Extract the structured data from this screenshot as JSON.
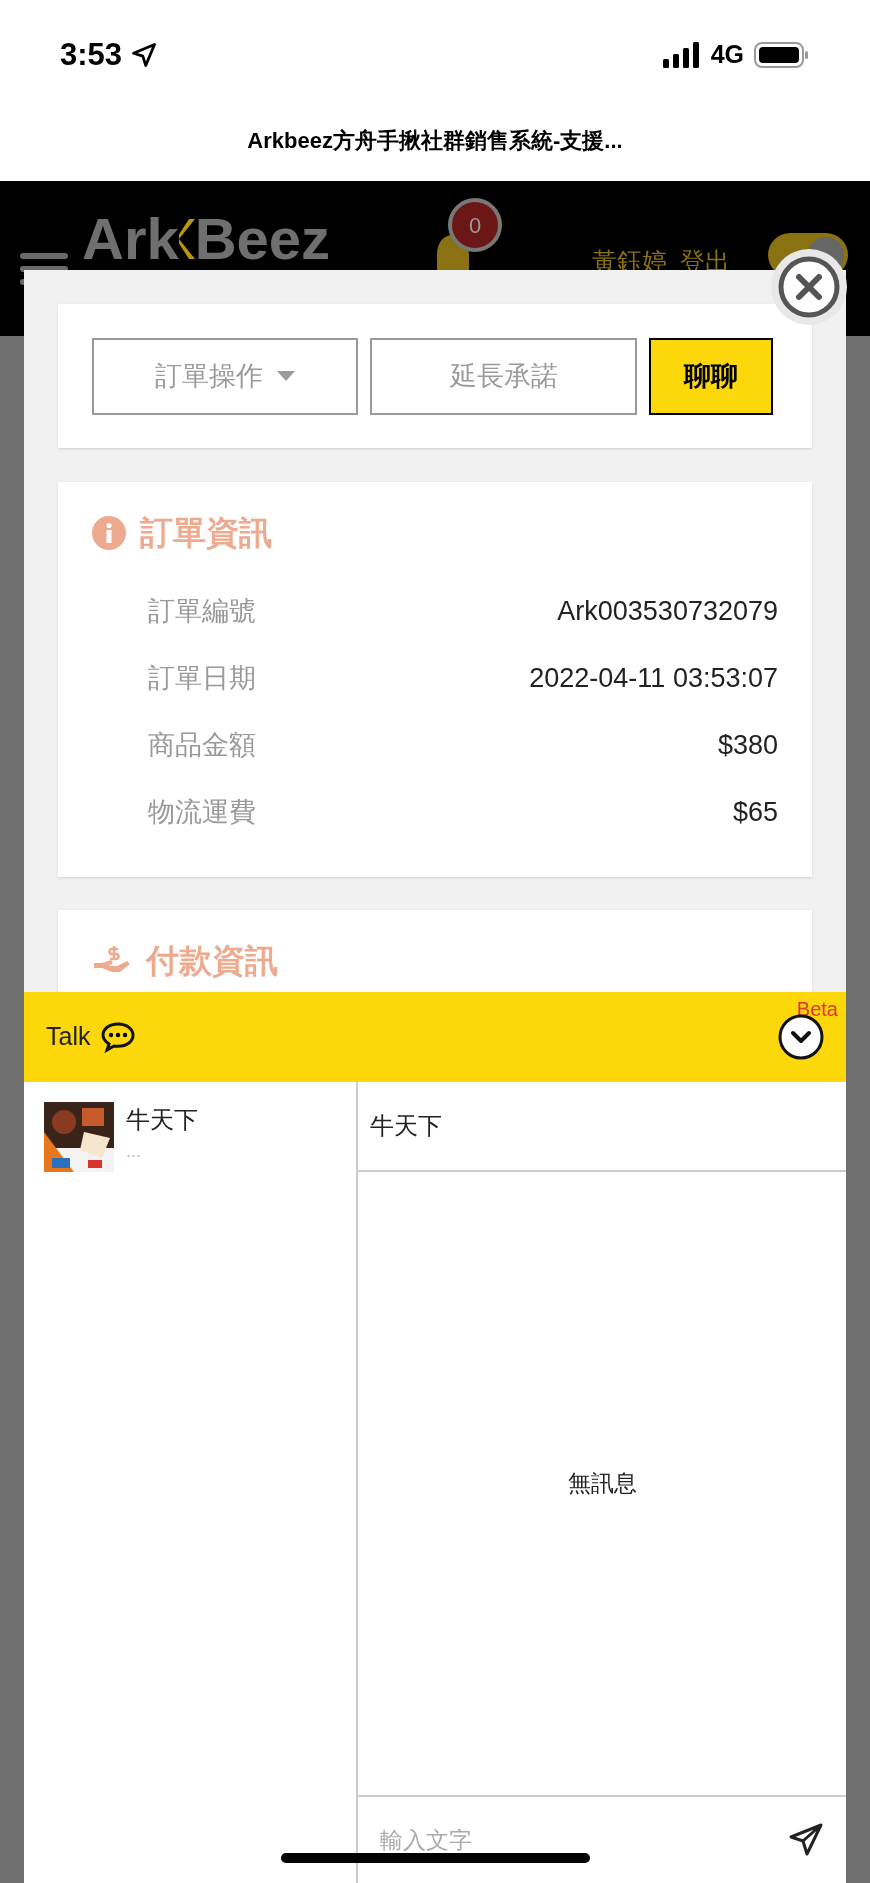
{
  "status_bar": {
    "time": "3:53",
    "network": "4G"
  },
  "browser": {
    "title": "Arkbeez方舟手揪社群銷售系統-支援..."
  },
  "header": {
    "logo": {
      "left": "Ark",
      "right": "Beez"
    },
    "notification_count": "0",
    "user_name": "黃鈺婷",
    "logout": "登出",
    "toggle_on": true
  },
  "actions": [
    {
      "kind": "dropdown",
      "label": "訂單操作"
    },
    {
      "kind": "outline",
      "label": "延長承諾"
    },
    {
      "kind": "primary",
      "label": "聊聊"
    }
  ],
  "order_info": {
    "title": "訂單資訊",
    "rows": [
      {
        "label": "訂單編號",
        "value": "Ark003530732079"
      },
      {
        "label": "訂單日期",
        "value": "2022-04-11 03:53:07"
      },
      {
        "label": "商品金額",
        "value": "$380"
      },
      {
        "label": "物流運費",
        "value": "$65"
      }
    ]
  },
  "payment_info": {
    "title": "付款資訊"
  },
  "chat": {
    "title": "Talk",
    "badge": "Beta",
    "conversations": [
      {
        "name": "牛天下",
        "preview": "...",
        "kind": "picture"
      }
    ],
    "active_title": "牛天下",
    "empty_text": "無訊息",
    "input_placeholder": "輸入文字"
  }
}
